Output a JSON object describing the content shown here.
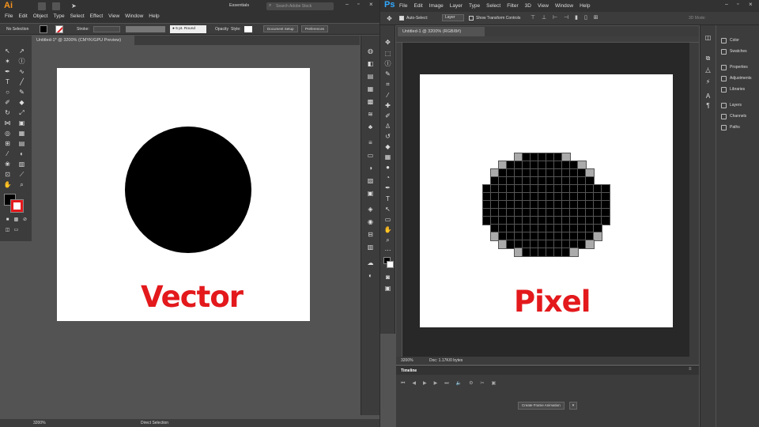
{
  "illustrator": {
    "logo": "Ai",
    "menu": [
      "File",
      "Edit",
      "Object",
      "Type",
      "Select",
      "Effect",
      "View",
      "Window",
      "Help"
    ],
    "workspace": "Essentials",
    "search_placeholder": "Search Adobe Stock",
    "control": {
      "selection": "No Selection",
      "stroke_label": "Stroke:",
      "brush": "5 pt. Round",
      "opacity_label": "Opacity",
      "style_label": "Style:",
      "document_setup": "Document Setup",
      "preferences": "Preferences"
    },
    "tab_title": "Untitled-1* @ 3200% (CMYK/GPU Preview)",
    "caption": "Vector",
    "zoom": "3200%",
    "status_tool": "Direct Selection"
  },
  "photoshop": {
    "logo": "Ps",
    "menu": [
      "File",
      "Edit",
      "Image",
      "Layer",
      "Type",
      "Select",
      "Filter",
      "3D",
      "View",
      "Window",
      "Help"
    ],
    "options": {
      "auto_select": "Auto-Select:",
      "layer": "Layer",
      "transform": "Show Transform Controls",
      "mode": "3D Mode:"
    },
    "tab_title": "Untitled-1 @ 3200% (RGB/8#)",
    "caption": "Pixel",
    "zoom": "3200%",
    "doc_info": "Doc: 1.17K/0 bytes",
    "timeline_title": "Timeline",
    "create_frame": "Create Frame Animation",
    "panels": {
      "group1": [
        "Color",
        "Swatches"
      ],
      "group2": [
        "Properties",
        "Adjustments",
        "Libraries"
      ],
      "group3": [
        "Layers",
        "Channels",
        "Paths"
      ]
    }
  },
  "colors": {
    "accent_red": "#e3191c",
    "ai_orange": "#f7941d",
    "ps_blue": "#31a8ff"
  },
  "pixel_grid": [
    "0000000000000000",
    "0000122222100000",
    "0012222222221000",
    "0122222222222100",
    "0222222222222200",
    "2222222222222222",
    "2222222222222222",
    "2222222222222222",
    "2222222222222222",
    "2222222222222222",
    "0222222222222220",
    "0122222222222210",
    "0012222222222100",
    "0000122222210000"
  ]
}
